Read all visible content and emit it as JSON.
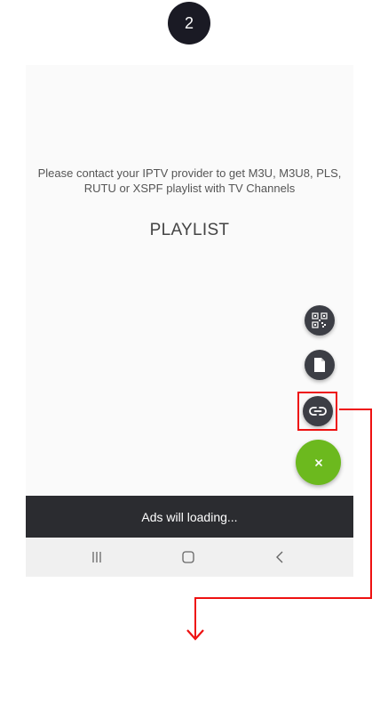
{
  "step": {
    "number": "2"
  },
  "main": {
    "message": "Please contact your IPTV provider to get M3U, M3U8, PLS, RUTU or XSPF playlist with TV Channels",
    "title": "PLAYLIST"
  },
  "fab_menu": {
    "items": [
      {
        "icon": "qr-code-icon"
      },
      {
        "icon": "file-icon"
      },
      {
        "icon": "link-icon"
      }
    ],
    "main_icon": "close-icon"
  },
  "ads": {
    "text": "Ads will loading..."
  },
  "nav": {
    "buttons": [
      "recent-apps-icon",
      "home-icon",
      "back-icon"
    ]
  },
  "colors": {
    "fab_dark": "#3c3e45",
    "fab_main": "#6cb91e",
    "highlight": "#e11111",
    "ads_bar": "#2b2c30"
  }
}
